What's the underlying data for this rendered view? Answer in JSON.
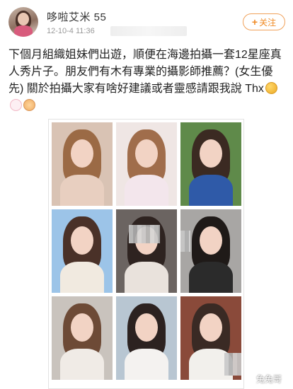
{
  "user": {
    "name": "哆啦艾米 55",
    "timestamp": "12-10-4 11:36"
  },
  "follow_button": {
    "plus": "+",
    "label": "关注",
    "color": "#f08a24"
  },
  "post": {
    "text": "下個月組織姐妹們出遊，順便在海邊拍攝一套12星座真人秀片子。朋友們有木有專業的攝影師推薦？(女生優先) 關於拍攝大家有啥好建議或者靈感請跟我說 Thx"
  },
  "emojis": [
    "blush-icon",
    "rabbit-icon",
    "handshake-icon"
  ],
  "photos": [
    {
      "name": "photo-1",
      "bg": "#d9c3b4",
      "hair": "#9b6a45",
      "cloth": "#e8cfc0"
    },
    {
      "name": "photo-2",
      "bg": "#efe6e4",
      "hair": "#a06d4b",
      "cloth": "#f3e6ec"
    },
    {
      "name": "photo-3",
      "bg": "#5f8a4a",
      "hair": "#3b2a22",
      "cloth": "#2f5aa8"
    },
    {
      "name": "photo-4",
      "bg": "#9cc4e8",
      "hair": "#4a3128",
      "cloth": "#f1eae0"
    },
    {
      "name": "photo-5",
      "bg": "#6b6461",
      "hair": "#2e2320",
      "cloth": "#e9e2dc"
    },
    {
      "name": "photo-6",
      "bg": "#a8a6a4",
      "hair": "#1f1a18",
      "cloth": "#2b2b2b"
    },
    {
      "name": "photo-7",
      "bg": "#c9c3bd",
      "hair": "#6d4a36",
      "cloth": "#f0ebe6"
    },
    {
      "name": "photo-8",
      "bg": "#b8c6d2",
      "hair": "#2c2220",
      "cloth": "#f4f2f0"
    },
    {
      "name": "photo-9",
      "bg": "#8a4a3a",
      "hair": "#3a2a24",
      "cloth": "#f2f0ec"
    }
  ],
  "watermark": "兔兔哥"
}
